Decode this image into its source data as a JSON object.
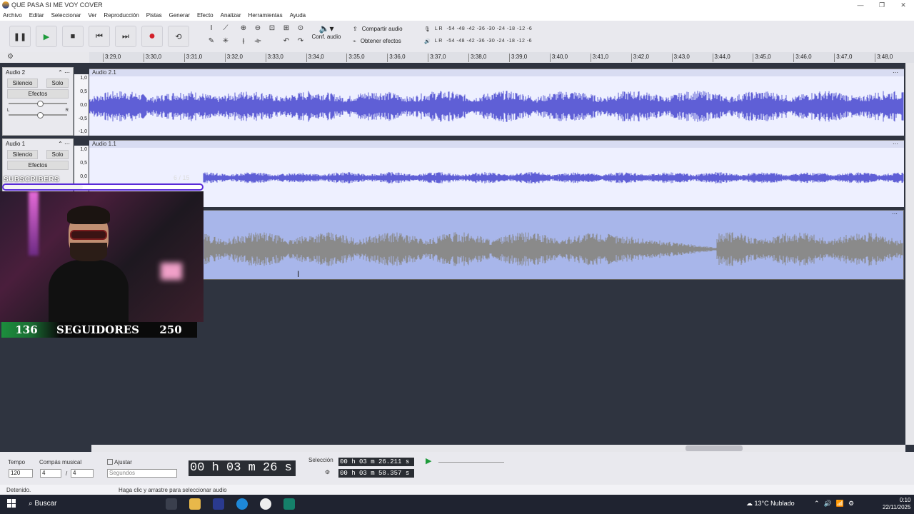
{
  "window": {
    "title": "QUE PASA SI ME VOY COVER",
    "controls": [
      "—",
      "❐",
      "✕"
    ]
  },
  "menu": [
    "Archivo",
    "Editar",
    "Seleccionar",
    "Ver",
    "Reproducción",
    "Pistas",
    "Generar",
    "Efecto",
    "Analizar",
    "Herramientas",
    "Ayuda"
  ],
  "toolbar": {
    "transport": {
      "pause": "❚❚",
      "play": "▶",
      "stop": "■",
      "skip_start": "⏮",
      "skip_end": "⏭",
      "record": "●",
      "loop": "⟲"
    },
    "conf_audio": "Conf. audio",
    "share_audio": "Compartir audio",
    "get_effects": "Obtener efectos",
    "meter_scale": "-54  -48  -42  -36  -30  -24  -18  -12  -6",
    "meter_rec_label": "L R",
    "meter_play_label": "L R"
  },
  "ruler": {
    "ticks": [
      "3:29,0",
      "3:30,0",
      "3:31,0",
      "3:32,0",
      "3:33,0",
      "3:34,0",
      "3:35,0",
      "3:36,0",
      "3:37,0",
      "3:38,0",
      "3:39,0",
      "3:40,0",
      "3:41,0",
      "3:42,0",
      "3:43,0",
      "3:44,0",
      "3:45,0",
      "3:46,0",
      "3:47,0",
      "3:48,0"
    ]
  },
  "tracks": [
    {
      "name": "Audio 2",
      "mute": "Silencio",
      "solo": "Solo",
      "effects": "Efectos",
      "clip": "Audio 2.1",
      "scale": [
        "1,0",
        "0,5",
        "0,0",
        "-0,5",
        "-1,0"
      ],
      "pan_l": "L",
      "pan_r": "R"
    },
    {
      "name": "Audio 1",
      "mute": "Silencio",
      "solo": "Solo",
      "effects": "Efectos",
      "clip": "Audio 1.1",
      "scale": [
        "1,0",
        "0,5",
        "0,0"
      ]
    }
  ],
  "overlay": {
    "subscribers_label": "SUBSCRIBERS",
    "subscribers_progress": 0.4,
    "subscribers_count": "6 / 15",
    "followers_current": "136",
    "followers_label": "SEGUIDORES",
    "followers_goal": "250"
  },
  "bottombar": {
    "tempo_label": "Tempo",
    "tempo_value": "120",
    "meter_label": "Compás musical",
    "meter_num": "4",
    "meter_den": "4",
    "snap_label": "Ajustar",
    "snap_unit": "Segundos",
    "time_display": "00 h 03 m 26 s",
    "selection_label": "Selección",
    "selection_start": "00 h 03 m 26.211 s",
    "selection_end": "00 h 03 m 58.357 s"
  },
  "status": {
    "left": "Detenido.",
    "hint": "Haga clic y arrastre para seleccionar audio"
  },
  "taskbar": {
    "search": "Buscar",
    "weather": "13°C  Nublado",
    "time": "0:10",
    "date": "22/11/2025"
  },
  "colors": {
    "waveform_blue": "#5f5fd6",
    "waveform_gray": "#8a8a8a",
    "selection": "#a8b6ea",
    "background": "#2f3440"
  }
}
